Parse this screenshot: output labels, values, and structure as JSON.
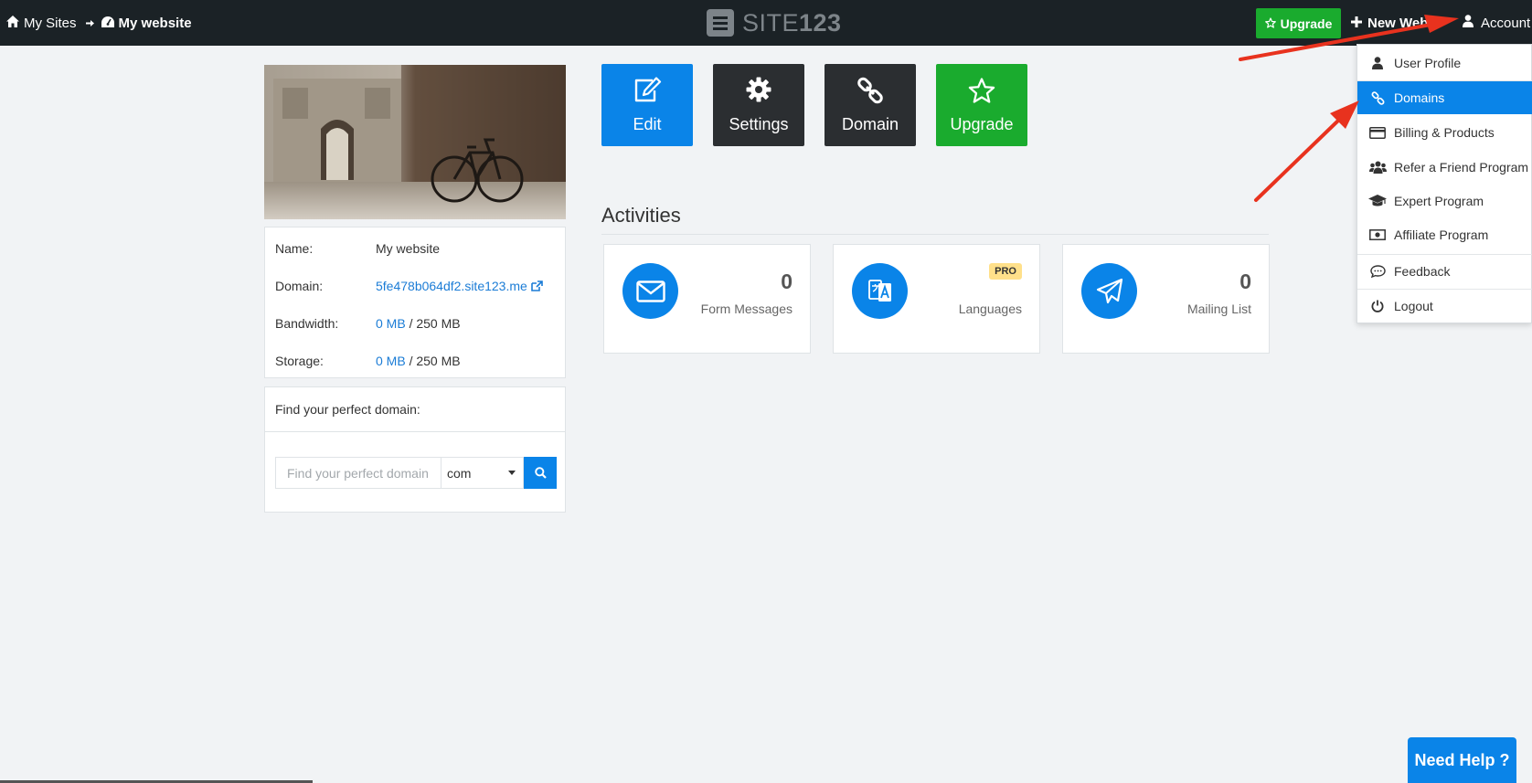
{
  "breadcrumb": {
    "my_sites": "My Sites",
    "current": "My website"
  },
  "logo": {
    "light": "SITE",
    "bold": "123"
  },
  "topbar": {
    "upgrade_label": "Upgrade",
    "new_website_label": "New Webs",
    "account_label": "Account"
  },
  "site_info": {
    "name_key": "Name:",
    "name_value": "My website",
    "domain_key": "Domain:",
    "domain_value": "5fe478b064df2.site123.me",
    "bandwidth_key": "Bandwidth:",
    "bandwidth_used": "0 MB",
    "bandwidth_total": "/ 250 MB",
    "storage_key": "Storage:",
    "storage_used": "0 MB",
    "storage_total": "/ 250 MB"
  },
  "domain_search": {
    "title": "Find your perfect domain:",
    "placeholder": "Find your perfect domain",
    "tld_selected": "com"
  },
  "actions": {
    "edit": "Edit",
    "settings": "Settings",
    "domain": "Domain",
    "upgrade": "Upgrade"
  },
  "activities": {
    "title": "Activities",
    "cards": [
      {
        "count": "0",
        "label": "Form Messages",
        "icon": "envelope-icon"
      },
      {
        "badge": "PRO",
        "label": "Languages",
        "icon": "translate-icon"
      },
      {
        "count": "0",
        "label": "Mailing List",
        "icon": "paper-plane-icon"
      }
    ]
  },
  "account_menu": [
    {
      "label": "User Profile",
      "icon": "user-icon"
    },
    {
      "label": "Domains",
      "icon": "link-icon",
      "active": true
    },
    {
      "label": "Billing & Products",
      "icon": "credit-card-icon"
    },
    {
      "label": "Refer a Friend Program",
      "icon": "users-icon"
    },
    {
      "label": "Expert Program",
      "icon": "graduation-cap-icon"
    },
    {
      "label": "Affiliate Program",
      "icon": "money-bill-icon"
    },
    {
      "label": "Feedback",
      "icon": "comment-icon"
    },
    {
      "label": "Logout",
      "icon": "power-icon"
    }
  ],
  "help": {
    "label": "Need Help ?"
  },
  "colors": {
    "topbar": "#1b2226",
    "primary": "#0a84e8",
    "success": "#1aab2e",
    "dark_tile": "#2b2e31",
    "annotation_arrow": "#e8321e"
  }
}
